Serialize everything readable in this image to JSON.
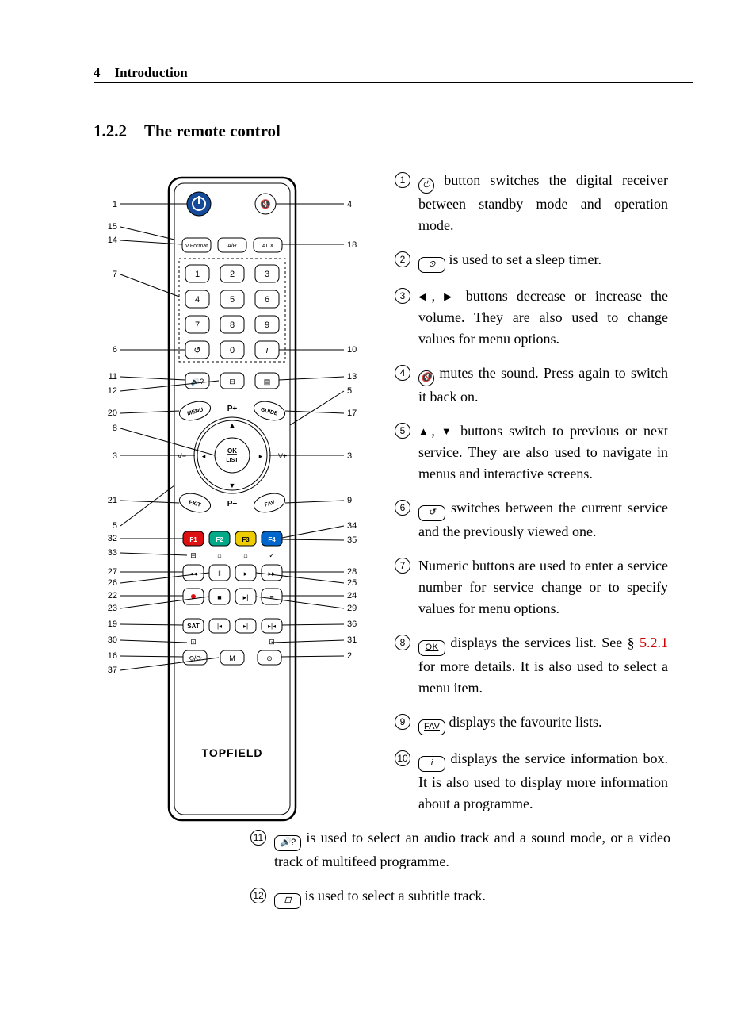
{
  "header": {
    "page_number": "4",
    "chapter": "Introduction"
  },
  "section": {
    "number": "1.2.2",
    "title": "The remote control"
  },
  "remote_brand": "TOPFIELD",
  "items": {
    "1": " button switches the digital receiver between standby mode and operation mode.",
    "2": " is used to set a sleep timer.",
    "3_pre": " ",
    "3_mid": ", ",
    "3_post": " buttons decrease or increase the volume. They are also used to change values for menu options.",
    "4": " mutes the sound. Press again to switch it back on.",
    "5_pre": " ",
    "5_mid": ", ",
    "5_post": " buttons switch to previous or next service. They are also used to navigate in menus and interactive screens.",
    "6": " switches between the current service and the previously viewed one.",
    "7": "Numeric buttons are used to enter a service number for service change or to specify values for menu options.",
    "8_a": " displays the services list. See § ",
    "8_link": "5.2.1",
    "8_b": " for more details. It is also used to select a menu item.",
    "9": " displays the favourite lists.",
    "10": " displays the service information box. It is also used to display more information about a programme.",
    "11": " is used to select an audio track and a sound mode, or a video track of multifeed programme.",
    "12": " is used to select a subtitle track."
  },
  "icon_labels": {
    "ok": "OK",
    "fav": "FAV",
    "i": "i"
  },
  "buttons": {
    "vformat": "V.Format",
    "ar": "A/R",
    "aux": "AUX",
    "menu": "MENU",
    "guide": "GUIDE",
    "exit": "EXIT",
    "fav": "FAV",
    "ok": "OK",
    "list": "LIST",
    "sat": "SAT",
    "m": "M",
    "f1": "F1",
    "f2": "F2",
    "f3": "F3",
    "f4": "F4"
  },
  "labels": {
    "v_minus": "V−",
    "v_plus": "V+",
    "p_plus": "P+",
    "p_minus": "P−"
  },
  "leader_numbers": {
    "left": [
      "1",
      "15",
      "14",
      "7",
      "6",
      "11",
      "12",
      "20",
      "8",
      "3",
      "21",
      "5",
      "32",
      "33",
      "27",
      "26",
      "22",
      "23",
      "19",
      "30",
      "16",
      "37"
    ],
    "right": [
      "4",
      "18",
      "10",
      "13",
      "5",
      "17",
      "3",
      "9",
      "34",
      "35",
      "28",
      "25",
      "24",
      "29",
      "36",
      "31",
      "2"
    ]
  }
}
